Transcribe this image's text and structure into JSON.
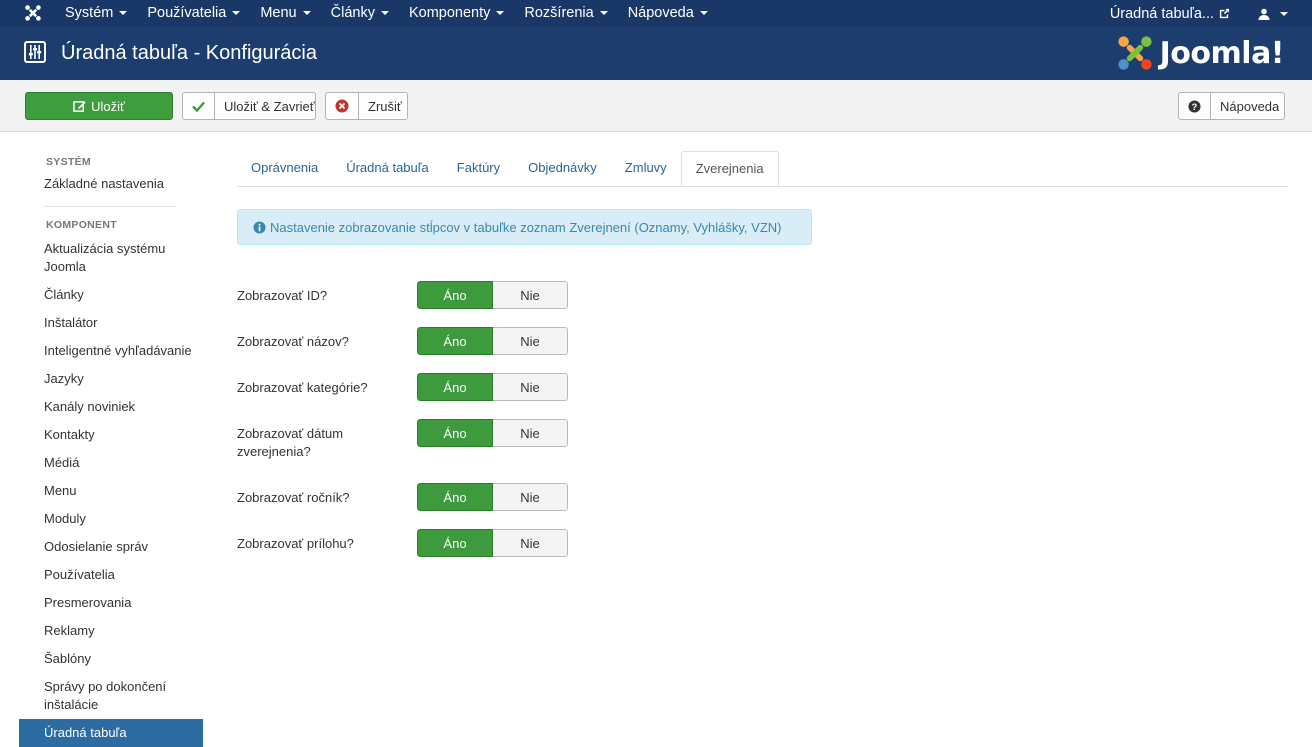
{
  "topnav": {
    "menu": [
      "Systém",
      "Používatelia",
      "Menu",
      "Články",
      "Komponenty",
      "Rozšírenia",
      "Nápoveda"
    ],
    "site_link": "Úradná tabuľa..."
  },
  "header": {
    "title": "Úradná tabuľa - Konfigurácia",
    "brand": "Joomla!"
  },
  "toolbar": {
    "save_label": "Uložiť",
    "save_close_label": "Uložiť & Zavrieť",
    "cancel_label": "Zrušiť",
    "help_label": "Nápoveda"
  },
  "sidebar": {
    "system_heading": "SYSTÉM",
    "system_items": [
      "Základné nastavenia"
    ],
    "component_heading": "KOMPONENT",
    "component_items": [
      "Aktualizácia systému Joomla",
      "Články",
      "Inštalátor",
      "Inteligentné vyhľadávanie",
      "Jazyky",
      "Kanály noviniek",
      "Kontakty",
      "Médiá",
      "Menu",
      "Moduly",
      "Odosielanie správ",
      "Používatelia",
      "Presmerovania",
      "Reklamy",
      "Šablóny",
      "Správy po dokončení inštalácie",
      "Úradná tabuľa"
    ],
    "active_item": "Úradná tabuľa"
  },
  "tabs": [
    "Oprávnenia",
    "Úradná tabuľa",
    "Faktúry",
    "Objednávky",
    "Zmluvy",
    "Zverejnenia"
  ],
  "active_tab": "Zverejnenia",
  "alert": {
    "text": "Nastavenie zobrazovanie stĺpcov v tabuľke zoznam Zverejnení (Oznamy, Vyhlášky, VZN)"
  },
  "fields": [
    {
      "label": "Zobrazovať ID?",
      "yes": "Áno",
      "no": "Nie",
      "selected": "Áno"
    },
    {
      "label": "Zobrazovať názov?",
      "yes": "Áno",
      "no": "Nie",
      "selected": "Áno"
    },
    {
      "label": "Zobrazovať kategórie?",
      "yes": "Áno",
      "no": "Nie",
      "selected": "Áno"
    },
    {
      "label": "Zobrazovať dátum zverejnenia?",
      "yes": "Áno",
      "no": "Nie",
      "selected": "Áno"
    },
    {
      "label": "Zobrazovať ročník?",
      "yes": "Áno",
      "no": "Nie",
      "selected": "Áno"
    },
    {
      "label": "Zobrazovať prílohu?",
      "yes": "Áno",
      "no": "Nie",
      "selected": "Áno"
    }
  ],
  "colors": {
    "nav_bg": "#1a3867",
    "header_bg": "#1c3d6e",
    "success": "#3d9a3d",
    "link": "#2a6496",
    "active_sidebar": "#2d6ca2",
    "info_bg": "#d9edf7"
  }
}
